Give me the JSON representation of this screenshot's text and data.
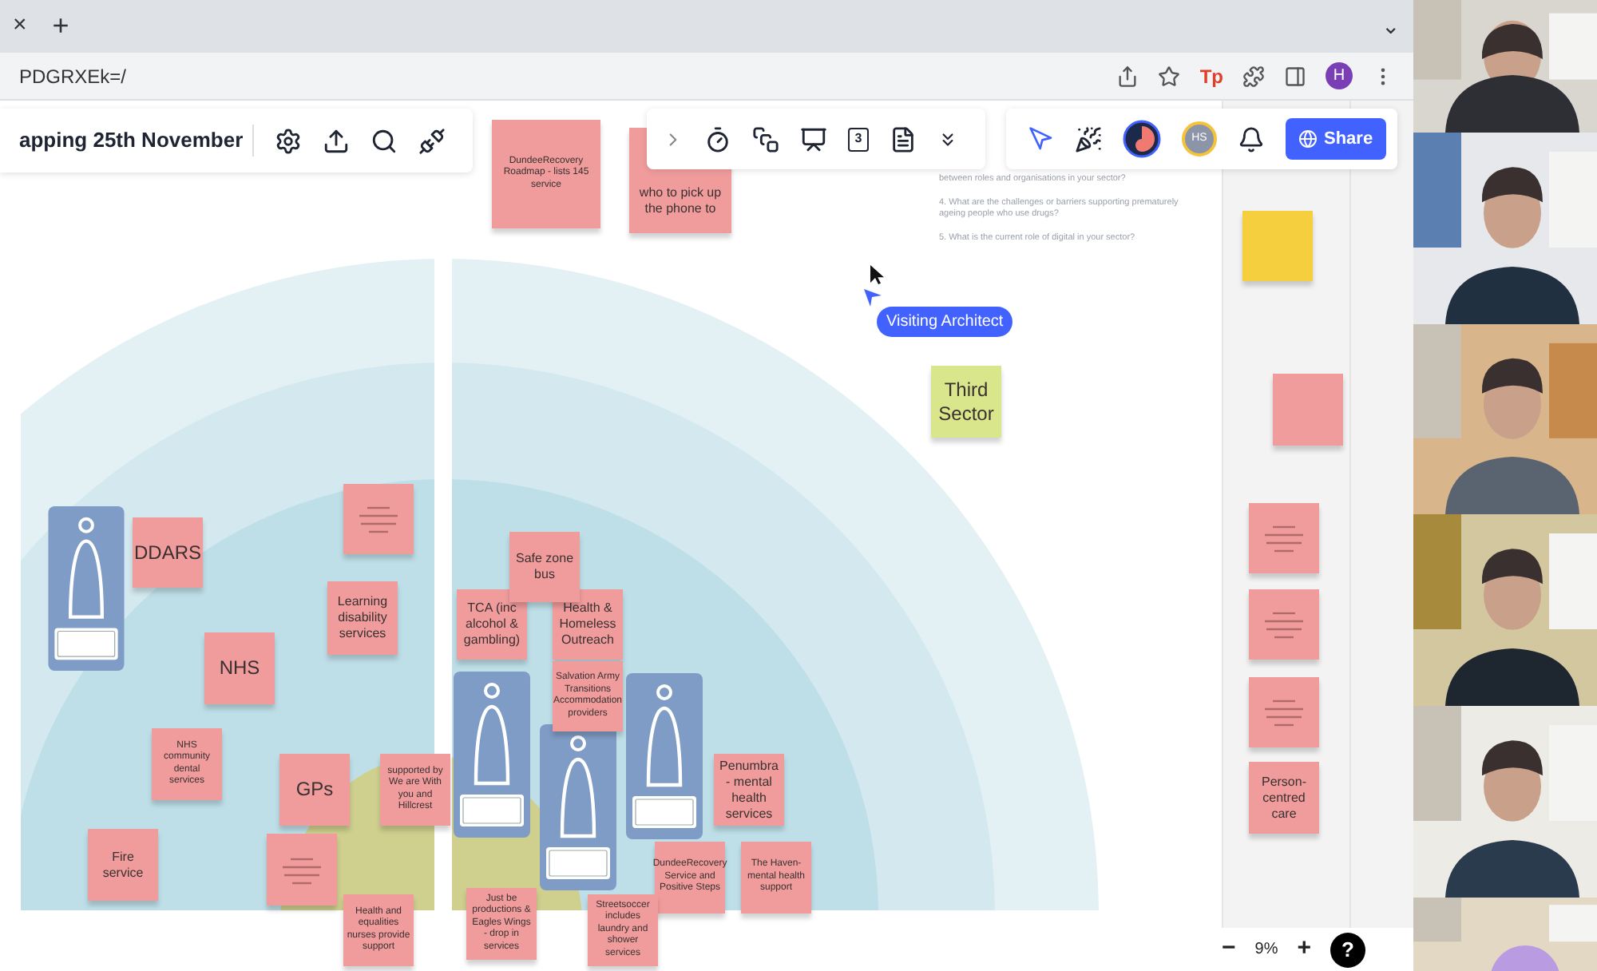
{
  "browser": {
    "tab_close": "×",
    "new_tab": "+",
    "tab_menu": "⌄",
    "address": "PDGRXEk=/",
    "extension_label": "Tp",
    "profile_initial": "H"
  },
  "toolbar": {
    "title": "apping 25th November",
    "calendar_day": "3",
    "collaborator_initials": "HS",
    "share": "Share"
  },
  "questions": [
    "between roles and organisations in your sector?",
    "4. What are the challenges or barriers supporting prematurely ageing people who use drugs?",
    "5. What is the current role of digital in your sector?"
  ],
  "cursor_label": "Visiting Architect",
  "notes": [
    {
      "kind": "detail",
      "color": "#f19c9c",
      "text": "DundeeRecovery Roadmap - lists 145 service"
    },
    {
      "kind": "covered",
      "color": "#f19c9c",
      "text": "who to pick up the phone to"
    },
    {
      "kind": "title",
      "color": "#d9e68c",
      "text": "Third Sector"
    },
    {
      "kind": "blank",
      "color": "#f5cf3d"
    },
    {
      "kind": "blank",
      "color": "#f19c9c"
    },
    {
      "kind": "scribble",
      "color": "#f19c9c"
    },
    {
      "kind": "scribble",
      "color": "#f19c9c"
    },
    {
      "kind": "scribble",
      "color": "#f19c9c"
    },
    {
      "kind": "mid",
      "color": "#f19c9c",
      "text": "Person-centred care"
    },
    {
      "kind": "title",
      "color": "#f19c9c",
      "text": "DDARS"
    },
    {
      "kind": "scribble",
      "color": "#f19c9c"
    },
    {
      "kind": "mid",
      "color": "#f19c9c",
      "text": "Learning disability services"
    },
    {
      "kind": "title",
      "color": "#f19c9c",
      "text": "NHS"
    },
    {
      "kind": "detail",
      "color": "#f19c9c",
      "text": "NHS community dental services"
    },
    {
      "kind": "title",
      "color": "#f19c9c",
      "text": "GPs"
    },
    {
      "kind": "detail",
      "color": "#f19c9c",
      "text": "supported by We are With you and Hillcrest"
    },
    {
      "kind": "mid",
      "color": "#f19c9c",
      "text": "Fire service"
    },
    {
      "kind": "scribble",
      "color": "#f19c9c"
    },
    {
      "kind": "detail",
      "color": "#f19c9c",
      "text": "Health and equalities nurses provide support"
    },
    {
      "kind": "mid",
      "color": "#f19c9c",
      "text": "TCA (inc alcohol & gambling)"
    },
    {
      "kind": "mid",
      "color": "#f19c9c",
      "text": "Health & Homeless Outreach"
    },
    {
      "kind": "mid",
      "color": "#f19c9c",
      "text": "Safe zone bus"
    },
    {
      "kind": "detail",
      "color": "#f19c9c",
      "text": "Salvation Army Transitions Accommodation providers"
    },
    {
      "kind": "mid",
      "color": "#f19c9c",
      "text": "Penumbra - mental health services"
    },
    {
      "kind": "detail",
      "color": "#f19c9c",
      "text": "DundeeRecovery Service and Positive Steps"
    },
    {
      "kind": "detail",
      "color": "#f19c9c",
      "text": "The Haven-mental health support"
    },
    {
      "kind": "detail",
      "color": "#f19c9c",
      "text": "Just be productions & Eagles Wings - drop in services"
    },
    {
      "kind": "detail",
      "color": "#f19c9c",
      "text": "Streetsoccer includes laundry and shower services"
    }
  ],
  "zoom": {
    "minus": "−",
    "level": "9%",
    "plus": "+",
    "help": "?"
  }
}
